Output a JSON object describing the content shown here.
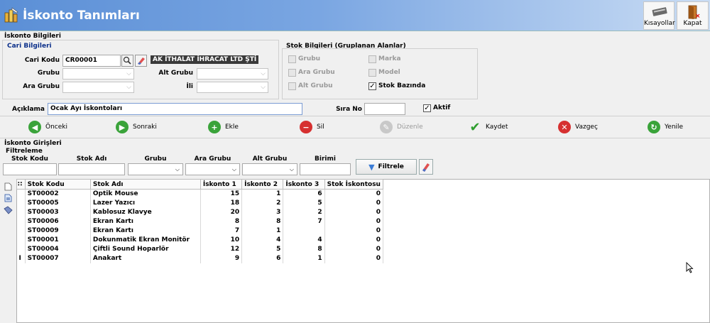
{
  "header": {
    "title": "İskonto Tanımları",
    "shortcuts_label": "Kısayollar",
    "close_label": "Kapat"
  },
  "info": {
    "section_title": "İskonto Bilgileri",
    "cari_section": "Cari Bilgileri",
    "cari_kodu_label": "Cari Kodu",
    "cari_kodu_value": "CR00001",
    "cari_name": "AK İTHALAT İHRACAT LTD ŞTİ",
    "grubu_label": "Grubu",
    "alt_grubu_label": "Alt Grubu",
    "ara_grubu_label": "Ara Grubu",
    "ili_label": "İli",
    "stok_section": "Stok Bilgileri (Gruplanan Alanlar)",
    "stok_grubu": "Grubu",
    "stok_marka": "Marka",
    "stok_ara_grubu": "Ara Grubu",
    "stok_model": "Model",
    "stok_alt_grubu": "Alt Grubu",
    "stok_bazinda": "Stok Bazında",
    "aciklama_label": "Açıklama",
    "aciklama_value": "Ocak Ayı İskontoları",
    "sira_no_label": "Sıra No",
    "sira_no_value": "",
    "aktif_label": "Aktif"
  },
  "nav": {
    "onceki": "Önceki",
    "sonraki": "Sonraki",
    "ekle": "Ekle",
    "sil": "Sil",
    "duzenle": "Düzenle",
    "kaydet": "Kaydet",
    "vazgec": "Vazgeç",
    "yenile": "Yenile"
  },
  "entries": {
    "section_title": "İskonto Girişleri",
    "filter_title": "Filtreleme",
    "f_stok_kodu": "Stok Kodu",
    "f_stok_adi": "Stok Adı",
    "f_grubu": "Grubu",
    "f_ara_grubu": "Ara Grubu",
    "f_alt_grubu": "Alt Grubu",
    "f_birimi": "Birimi",
    "filtrele_label": "Filtrele"
  },
  "grid": {
    "headers": [
      "Stok Kodu",
      "Stok Adı",
      "İskonto 1",
      "İskonto 2",
      "İskonto 3",
      "Stok İskontosu"
    ],
    "rows": [
      [
        "ST00002",
        "Optik Mouse",
        "15",
        "1",
        "6",
        "0"
      ],
      [
        "ST00005",
        "Lazer Yazıcı",
        "18",
        "2",
        "5",
        "0"
      ],
      [
        "ST00003",
        "Kablosuz Klavye",
        "20",
        "3",
        "2",
        "0"
      ],
      [
        "ST00006",
        "Ekran Kartı",
        "8",
        "8",
        "7",
        "0"
      ],
      [
        "ST00009",
        "Ekran   Kartı",
        "7",
        "1",
        "",
        "0"
      ],
      [
        "ST00001",
        "Dokunmatik Ekran Monitör",
        "10",
        "4",
        "4",
        "0"
      ],
      [
        "ST00004",
        "Çiftli Sound Hoparlör",
        "12",
        "5",
        "8",
        "0"
      ],
      [
        "ST00007",
        "Anakart",
        "9",
        "6",
        "1",
        "0"
      ]
    ]
  },
  "colors": {
    "header_start": "#5b8fd6",
    "header_end": "#c9dcf4",
    "section_blue": "#0b2f8a"
  }
}
